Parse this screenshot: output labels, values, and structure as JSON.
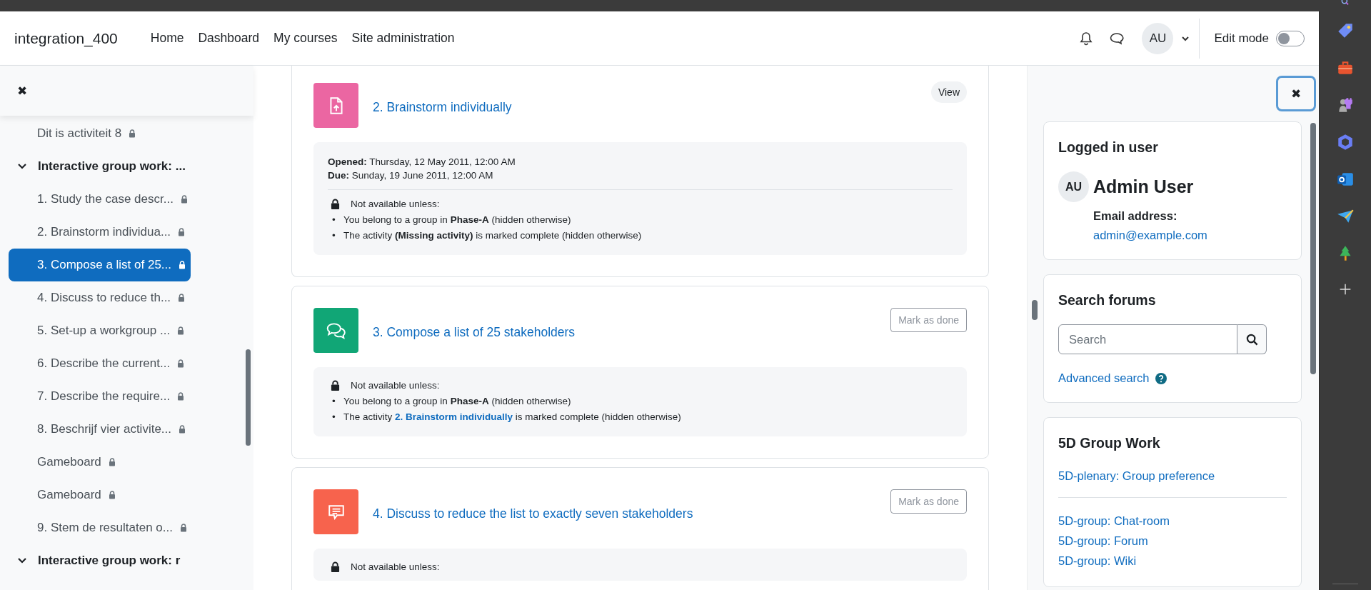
{
  "header": {
    "site_name": "integration_400",
    "nav": [
      {
        "label": "Home",
        "selected": false
      },
      {
        "label": "Dashboard",
        "selected": false
      },
      {
        "label": "My courses",
        "selected": false
      },
      {
        "label": "Site administration",
        "selected": false
      }
    ],
    "avatar": "AU",
    "edit_mode": {
      "label": "Edit mode",
      "on": false
    }
  },
  "course_index": {
    "close": "✖",
    "items": [
      {
        "kind": "activity",
        "label": "Dit is activiteit 8",
        "locked": true,
        "selected": false
      },
      {
        "kind": "section",
        "label": "Interactive group work: ...",
        "expanded": true,
        "children": [
          {
            "kind": "activity",
            "label": "1. Study the case descr...",
            "locked": true,
            "selected": false
          },
          {
            "kind": "activity",
            "label": "2. Brainstorm individua...",
            "locked": true,
            "selected": false
          },
          {
            "kind": "activity",
            "label": "3. Compose a list of 25...",
            "locked": true,
            "selected": true
          },
          {
            "kind": "activity",
            "label": "4. Discuss to reduce th...",
            "locked": true,
            "selected": false
          },
          {
            "kind": "activity",
            "label": "5. Set-up a workgroup ...",
            "locked": true,
            "selected": false
          },
          {
            "kind": "activity",
            "label": "6. Describe the current...",
            "locked": true,
            "selected": false
          },
          {
            "kind": "activity",
            "label": "7. Describe the require...",
            "locked": true,
            "selected": false
          },
          {
            "kind": "activity",
            "label": "8. Beschrijf vier activite...",
            "locked": true,
            "selected": false
          },
          {
            "kind": "activity",
            "label": "Gameboard",
            "locked": true,
            "selected": false
          },
          {
            "kind": "activity",
            "label": "Gameboard",
            "locked": true,
            "selected": false
          },
          {
            "kind": "activity",
            "label": "9. Stem de resultaten o...",
            "locked": true,
            "selected": false
          }
        ]
      },
      {
        "kind": "section",
        "label": "Interactive group work: r",
        "expanded": true
      }
    ]
  },
  "activities": [
    {
      "kind": "assignment",
      "color": "#eb66a2",
      "title": "2. Brainstorm individually",
      "button": {
        "kind": "view",
        "label": "View"
      },
      "dates": [
        "**Opened:** Thursday, 12 May 2011, 12:00 AM",
        "**Due:** Sunday, 19 June 2011, 12:00 AM"
      ],
      "restriction": {
        "header": "Not available unless:",
        "items": [
          {
            "marker": "•",
            "text": "You belong to a group in **Phase-A** (hidden otherwise)"
          },
          {
            "marker": "•",
            "text": "The activity **(Missing activity)** is marked complete (hidden otherwise)"
          }
        ]
      }
    },
    {
      "kind": "forum",
      "color": "#11a676",
      "title": "3. Compose a list of 25 stakeholders",
      "button": {
        "kind": "mark",
        "label": "Mark as done"
      },
      "restriction": {
        "header": "Not available unless:",
        "items": [
          {
            "marker": "•",
            "text": "You belong to a group in **Phase-A** (hidden otherwise)"
          },
          {
            "marker": "•",
            "text": "The activity ",
            "link": "2. Brainstorm individually",
            "after": " is marked complete (hidden otherwise)"
          }
        ]
      }
    },
    {
      "kind": "chat",
      "color": "#f7634d",
      "title": "4. Discuss to reduce the list to exactly seven stakeholders",
      "button": {
        "kind": "mark",
        "label": "Mark as done"
      },
      "restriction": {
        "header": "Not available unless:"
      }
    }
  ],
  "block_drawer": {
    "close": "✖",
    "blocks": [
      {
        "kind": "user",
        "title": "Logged in user",
        "avatar": "AU",
        "name": "Admin User",
        "email_label": "Email address:",
        "email": "admin@example.com"
      },
      {
        "kind": "search",
        "title": "Search forums",
        "placeholder": "Search",
        "link": "Advanced search"
      },
      {
        "kind": "links",
        "title": "5D Group Work",
        "groups": [
          [
            "5D-plenary: Group preference"
          ],
          [
            "5D-group: Chat-room",
            "5D-group: Forum",
            "5D-group: Wiki"
          ]
        ]
      }
    ]
  }
}
